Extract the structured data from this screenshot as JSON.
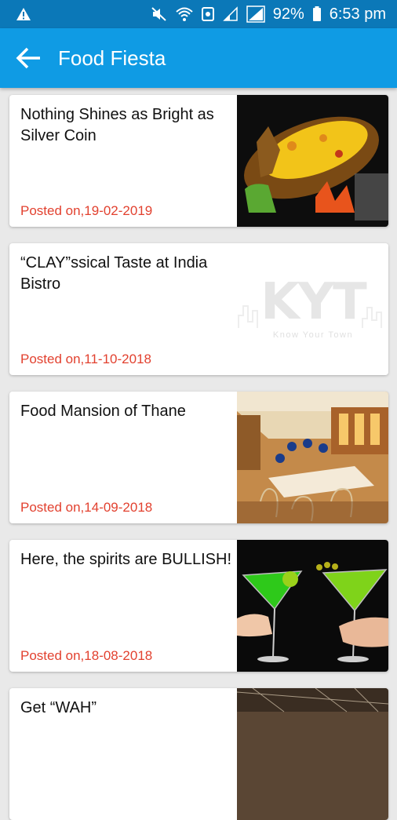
{
  "status_bar": {
    "battery": "92%",
    "time": "6:53 pm",
    "icons": [
      "warning-icon",
      "mute-icon",
      "wifi-icon",
      "data-icon",
      "signal-weak-icon",
      "signal-icon",
      "battery-icon"
    ]
  },
  "app_bar": {
    "title": "Food Fiesta",
    "back_icon": "arrow-left-icon"
  },
  "posts": [
    {
      "title": "Nothing Shines as Bright as Silver Coin",
      "date": "Posted on,19-02-2019",
      "image": "pineapple-rice-dish"
    },
    {
      "title": "“CLAY”ssical Taste at India Bistro",
      "date": "Posted on,11-10-2018",
      "image": "kyt-logo-placeholder",
      "logo_text": "KYT",
      "logo_tagline": "Know Your Town"
    },
    {
      "title": "Food Mansion of Thane",
      "date": "Posted on,14-09-2018",
      "image": "restaurant-interior"
    },
    {
      "title": "Here, the spirits are BULLISH!",
      "date": "Posted on,18-08-2018",
      "image": "cocktail-glasses"
    },
    {
      "title": "Get “WAH”",
      "date": "",
      "image": "partial-image"
    }
  ],
  "colors": {
    "status_bar": "#0b78b8",
    "app_bar": "#0f9be4",
    "date_text": "#e2412f",
    "background": "#e9e9e9"
  }
}
